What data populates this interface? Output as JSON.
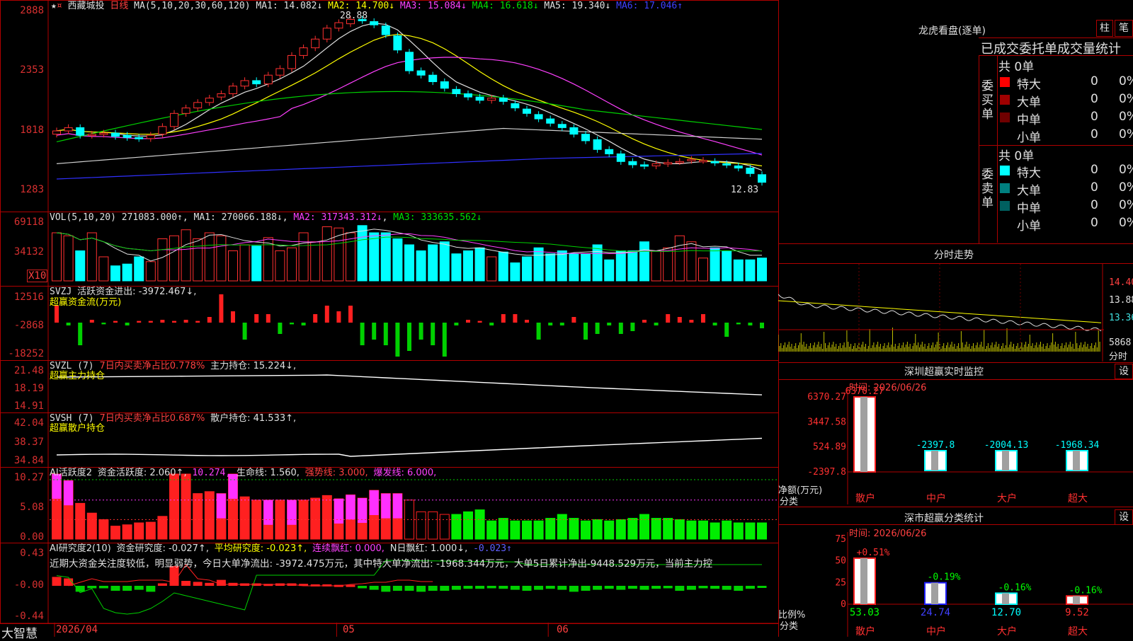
{
  "stock": {
    "name": "西藏城投",
    "period": "日线",
    "star_icon": "★",
    "flag_icon": "¤",
    "bottom_logo": "大智慧"
  },
  "price_panel": {
    "ma_label": "MA(5,10,20,30,60,120)",
    "mas": [
      {
        "label": "MA1: 14.082↓",
        "color": "#e0e0e0"
      },
      {
        "label": "MA2: 14.700↓",
        "color": "#ffff00"
      },
      {
        "label": "MA3: 15.084↓",
        "color": "#ff40ff"
      },
      {
        "label": "MA4: 16.618↓",
        "color": "#00e000"
      },
      {
        "label": "MA5: 19.340↓",
        "color": "#e0e0e0"
      },
      {
        "label": "MA6: 17.046↑",
        "color": "#4040ff"
      }
    ],
    "y_ticks": [
      "2888",
      "2353",
      "1818",
      "1283"
    ],
    "high_label": "28.88",
    "low_label": "12.83"
  },
  "vol_panel": {
    "label": "VOL(5,10,20)",
    "value": "271083.000↑",
    "ma1": "MA1: 270066.188↓",
    "ma2": "MA2: 317343.312↓",
    "ma3": "MA3: 333635.562↓",
    "y_ticks": [
      "69118",
      "34132"
    ],
    "unit": "X10"
  },
  "svzj_panel": {
    "label": "SVZJ",
    "text": "活跃资金进出: -3972.467↓,",
    "subtitle": "超赢资金流(万元)",
    "y_ticks": [
      "12516",
      "-2868",
      "-18252"
    ]
  },
  "svzl_panel": {
    "label": "SVZL (7)",
    "ratio": "7日内买卖净占比0.778%",
    "hold": "主力持仓: 15.224↓,",
    "subtitle": "超赢主力持仓",
    "y_ticks": [
      "21.48",
      "18.19",
      "14.91"
    ]
  },
  "svsh_panel": {
    "label": "SVSH (7)",
    "ratio": "7日内买卖净占比0.687%",
    "hold": "散户持仓: 41.533↑,",
    "subtitle": "超赢散户持仓",
    "y_ticks": [
      "42.04",
      "38.37",
      "34.84"
    ]
  },
  "ai_active_panel": {
    "label": "AI活跃度2",
    "activity": "资金活跃度: 2.060↑,",
    "v2": "10.274,",
    "life": "生命线: 1.560,",
    "strong": "强势线: 3.000,",
    "burst": "爆发线: 6.000,",
    "y_ticks": [
      "10.27",
      "5.08",
      "0.00"
    ]
  },
  "ai_research_panel": {
    "label": "AI研究度2(10)",
    "research": "资金研究度: -0.027↑,",
    "avg": "平均研究度: -0.023↑,",
    "red": "连续飘红: 0.000,",
    "nred": "N日飘红: 1.000↓,",
    "last": "-0.023↑",
    "comment": "近期大资金关注度较低，明显弱势，今日大单净流出: -3972.475万元，其中特大单净流出: -1968.344万元，大单5日累计净出-9448.529万元，当前主力控",
    "y_ticks": [
      "0.43",
      "-0.00",
      "-0.44"
    ]
  },
  "x_axis": {
    "labels": [
      "2026/04",
      "05",
      "06"
    ]
  },
  "dragon_panel": {
    "title": "龙虎看盘(逐单)",
    "btn_bar": "柱",
    "btn_tick": "笔",
    "header": "已成交委托单成交量统计",
    "buy_side": "委买单",
    "sell_side": "委卖单",
    "buy_total": "共 0单",
    "sell_total": "共 0单",
    "buy_rows": [
      {
        "label": "特大",
        "count": "0",
        "pct": "0%",
        "color": "#ff0000"
      },
      {
        "label": "大单",
        "count": "0",
        "pct": "0%",
        "color": "#a00000"
      },
      {
        "label": "中单",
        "count": "0",
        "pct": "0%",
        "color": "#700000"
      },
      {
        "label": "小单",
        "count": "0",
        "pct": "0%",
        "color": "#000000"
      }
    ],
    "sell_rows": [
      {
        "label": "特大",
        "count": "0",
        "pct": "0%",
        "color": "#00ffff"
      },
      {
        "label": "大单",
        "count": "0",
        "pct": "0%",
        "color": "#008080"
      },
      {
        "label": "中单",
        "count": "0",
        "pct": "0%",
        "color": "#006060"
      },
      {
        "label": "小单",
        "count": "0",
        "pct": "0%",
        "color": "#000000"
      }
    ]
  },
  "intraday": {
    "title": "分时走势",
    "y_ticks": [
      "14.40",
      "13.88",
      "13.36"
    ],
    "vol_label": "5868",
    "vol_unit": "分时"
  },
  "monitor": {
    "title": "深圳超赢实时监控",
    "set_btn": "设",
    "time": "时间: 2026/06/26",
    "y_ticks": [
      "6370.27",
      "3447.58",
      "524.89",
      "-2397.8"
    ],
    "unit": "净额(万元)",
    "cat_label": "分类",
    "chart_data": {
      "type": "bar",
      "categories": [
        "散户",
        "中户",
        "大户",
        "超大"
      ],
      "values": [
        6370.27,
        -2397.8,
        -2004.13,
        -1968.34
      ],
      "value_labels": [
        "6370.27",
        "-2397.8",
        "-2004.13",
        "-1968.34"
      ],
      "ylim": [
        -2397.8,
        6370.27
      ]
    }
  },
  "classify": {
    "title": "深市超赢分类统计",
    "set_btn": "设",
    "time": "时间: 2026/06/26",
    "y_ticks": [
      "75",
      "50",
      "25",
      "0"
    ],
    "unit": "比例%",
    "cat_label": "分类",
    "chart_data": {
      "type": "bar",
      "categories": [
        "散户",
        "中户",
        "大户",
        "超大"
      ],
      "values": [
        53.03,
        24.74,
        12.7,
        9.52
      ],
      "value_labels": [
        "53.03",
        "24.74",
        "12.70",
        "9.52"
      ],
      "changes": [
        "+0.51%",
        "-0.19%",
        "-0.16%",
        "-0.16%"
      ],
      "ylim": [
        0,
        75
      ]
    }
  }
}
